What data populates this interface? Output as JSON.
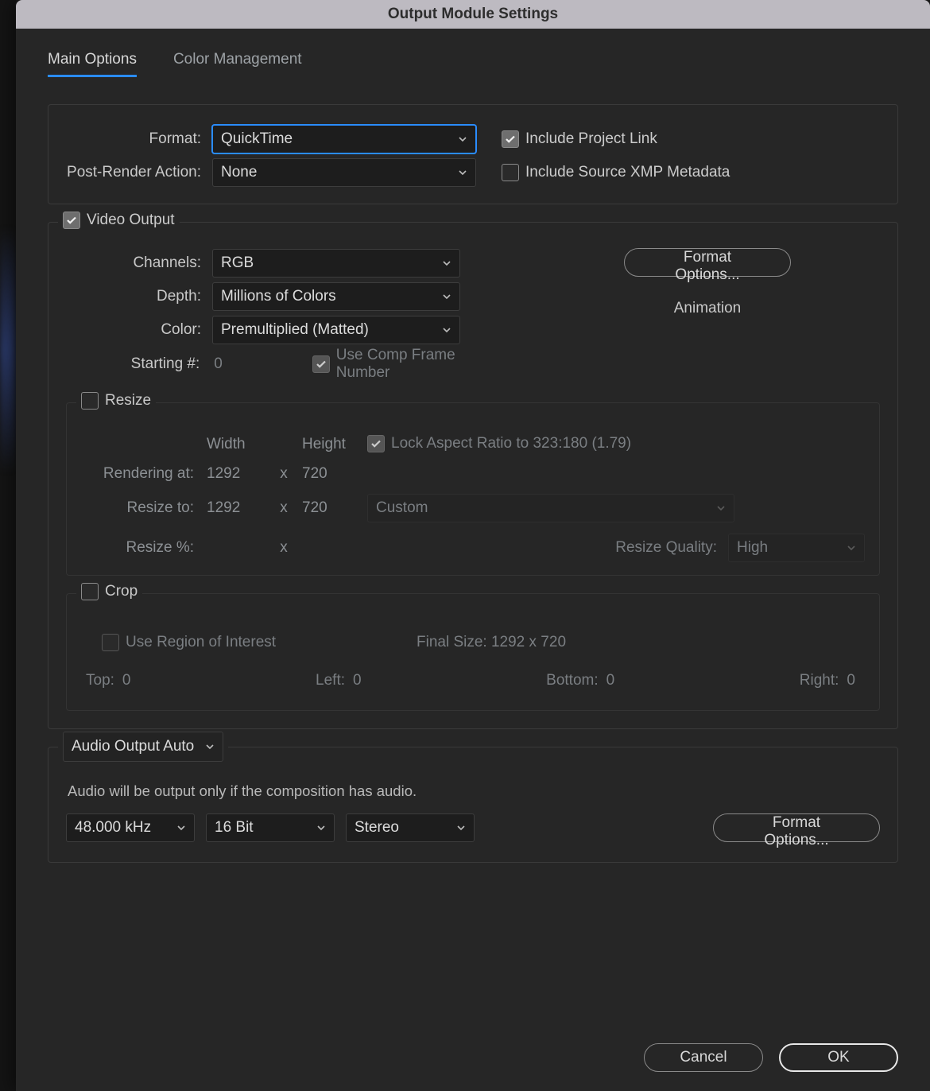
{
  "window": {
    "title": "Output Module Settings"
  },
  "tabs": {
    "main": "Main Options",
    "color": "Color Management"
  },
  "format": {
    "label": "Format:",
    "value": "QuickTime",
    "post_label": "Post-Render Action:",
    "post_value": "None",
    "include_link": "Include Project Link",
    "include_xmp": "Include Source XMP Metadata"
  },
  "video": {
    "legend": "Video Output",
    "channels_label": "Channels:",
    "channels_value": "RGB",
    "depth_label": "Depth:",
    "depth_value": "Millions of Colors",
    "color_label": "Color:",
    "color_value": "Premultiplied (Matted)",
    "starting_label": "Starting #:",
    "starting_value": "0",
    "use_comp": "Use Comp Frame Number",
    "format_options": "Format Options...",
    "codec": "Animation"
  },
  "resize": {
    "legend": "Resize",
    "width_h": "Width",
    "height_h": "Height",
    "lock_label": "Lock Aspect Ratio to 323:180 (1.79)",
    "rendering_label": "Rendering at:",
    "rendering_w": "1292",
    "rendering_h": "720",
    "resize_to_label": "Resize to:",
    "resize_w": "1292",
    "resize_h": "720",
    "resize_pct_label": "Resize %:",
    "preset": "Custom",
    "quality_label": "Resize Quality:",
    "quality_value": "High"
  },
  "crop": {
    "legend": "Crop",
    "roi": "Use Region of Interest",
    "final_label": "Final Size: 1292 x 720",
    "top_l": "Top:",
    "top_v": "0",
    "left_l": "Left:",
    "left_v": "0",
    "bottom_l": "Bottom:",
    "bottom_v": "0",
    "right_l": "Right:",
    "right_v": "0"
  },
  "audio": {
    "mode": "Audio Output Auto",
    "note": "Audio will be output only if the composition has audio.",
    "rate": "48.000 kHz",
    "bits": "16 Bit",
    "channels": "Stereo",
    "format_options": "Format Options..."
  },
  "buttons": {
    "cancel": "Cancel",
    "ok": "OK"
  },
  "glyphs": {
    "x": "x"
  }
}
